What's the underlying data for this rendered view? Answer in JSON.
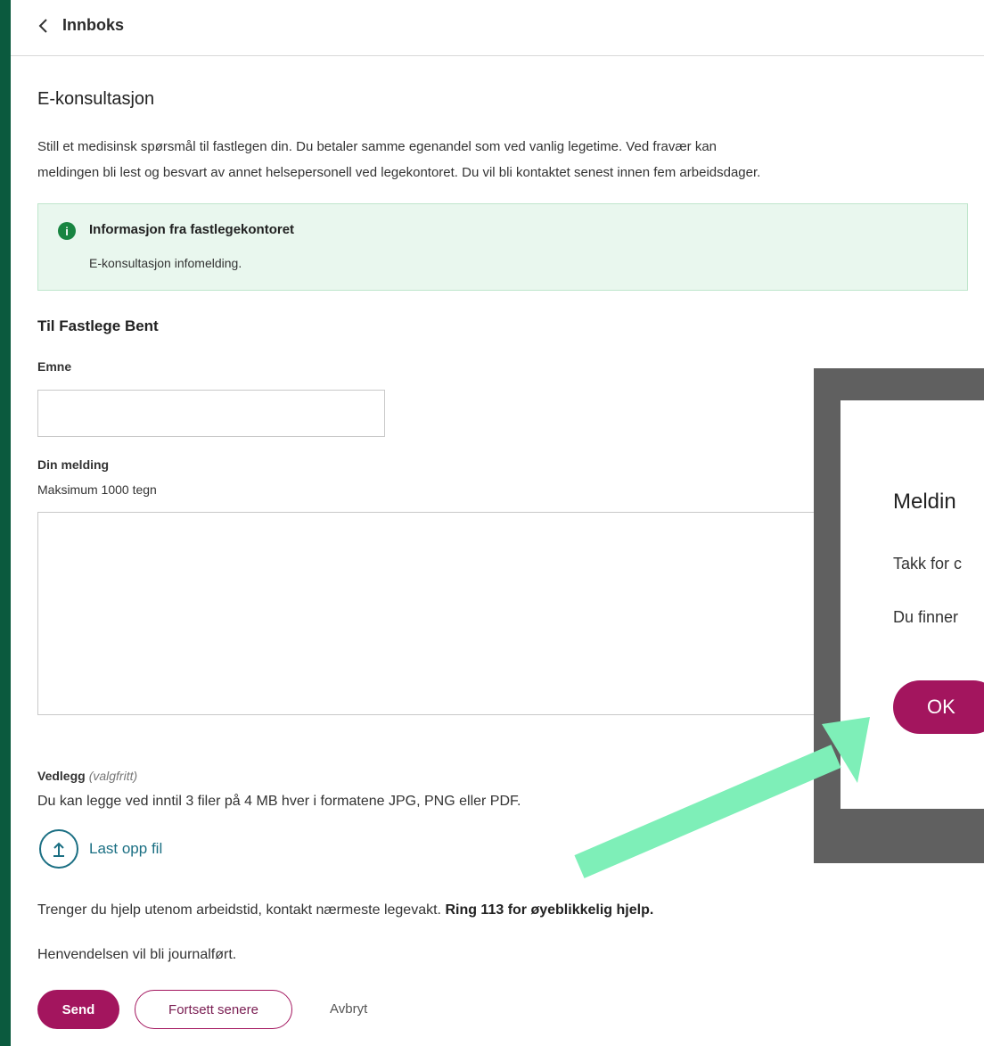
{
  "nav": {
    "back_label": "Innboks"
  },
  "page": {
    "title": "E-konsultasjon",
    "intro_line1": "Still et medisinsk spørsmål til fastlegen din. Du betaler samme egenandel som ved vanlig legetime. Ved fravær kan",
    "intro_line2": "meldingen bli lest og besvart av annet helsepersonell ved legekontoret. Du vil bli kontaktet senest innen fem arbeidsdager."
  },
  "info_box": {
    "icon": "info-icon",
    "title": "Informasjon fra fastlegekontoret",
    "text": "E-konsultasjon infomelding."
  },
  "form": {
    "recipient": "Til Fastlege Bent",
    "subject_label": "Emne",
    "subject_value": "",
    "message_label": "Din melding",
    "message_hint": "Maksimum 1000 tegn",
    "message_value": "",
    "attachment_label": "Vedlegg",
    "attachment_optional": "(valgfritt)",
    "attachment_desc": "Du kan legge ved inntil 3 filer på 4 MB hver i formatene JPG, PNG eller PDF.",
    "upload_label": "Last opp fil",
    "help_text": "Trenger du hjelp utenom arbeidstid, kontakt nærmeste legevakt.",
    "help_emphasis": "Ring 113 for øyeblikkelig hjelp.",
    "journal_text": "Henvendelsen vil bli journalført."
  },
  "actions": {
    "send": "Send",
    "later": "Fortsett senere",
    "cancel": "Avbryt"
  },
  "dialog": {
    "title": "Meldin",
    "text1": "Takk for c",
    "text2": "Du finner",
    "ok": "OK"
  },
  "colors": {
    "brand_green": "#0b5a3e",
    "primary_button": "#a3155e",
    "info_bg": "#e9f7ee",
    "link": "#1b6f83",
    "annotation_arrow": "#7eefb8"
  }
}
